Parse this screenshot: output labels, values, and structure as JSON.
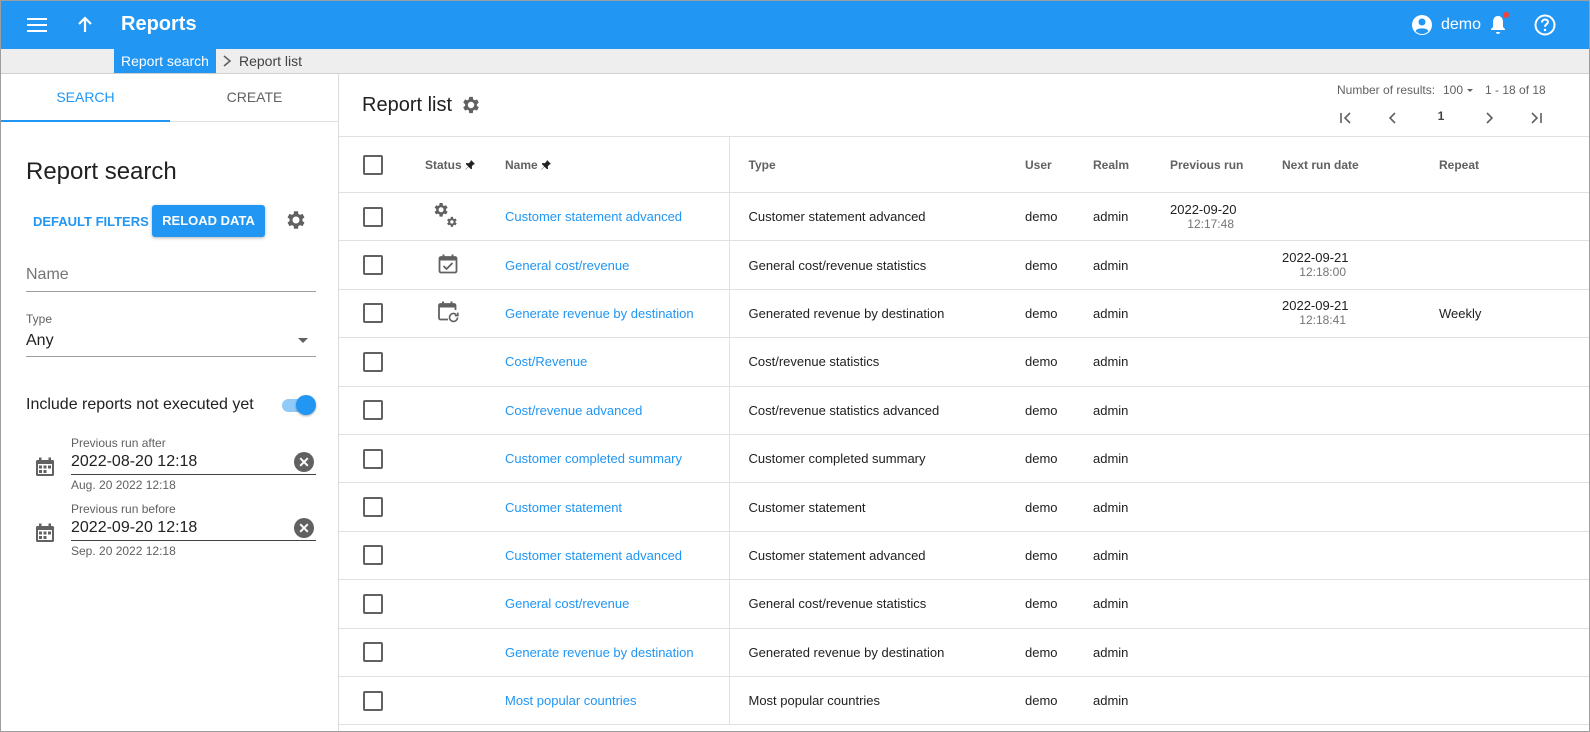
{
  "app": {
    "title": "Reports",
    "user": "demo"
  },
  "breadcrumb": {
    "link": "Report search",
    "current": "Report list"
  },
  "left": {
    "tabs": [
      {
        "label": "SEARCH"
      },
      {
        "label": "CREATE"
      }
    ],
    "title": "Report search",
    "default_filters": "DEFAULT FILTERS",
    "reload": "RELOAD DATA",
    "name_placeholder": "Name",
    "type_label": "Type",
    "type_value": "Any",
    "toggle_label": "Include reports not executed yet",
    "toggle_on": true,
    "after": {
      "label": "Previous run after",
      "value": "2022-08-20 12:18",
      "hint": "Aug. 20 2022 12:18"
    },
    "before": {
      "label": "Previous run before",
      "value": "2022-09-20 12:18",
      "hint": "Sep. 20 2022 12:18"
    }
  },
  "right": {
    "title": "Report list",
    "results_label": "Number of results:",
    "results_value": "100",
    "range": "1 - 18 of 18",
    "page": "1",
    "columns": {
      "status": "Status",
      "name": "Name",
      "type": "Type",
      "user": "User",
      "realm": "Realm",
      "prev": "Previous run",
      "next": "Next run date",
      "repeat": "Repeat"
    },
    "rows": [
      {
        "status": "gears-icon",
        "name": "Customer statement advanced",
        "type": "Customer statement advanced",
        "user": "demo",
        "realm": "admin",
        "prev_date": "2022-09-20",
        "prev_time": "12:17:48",
        "next_date": "",
        "next_time": "",
        "repeat": ""
      },
      {
        "status": "calendar-check-icon",
        "name": "General cost/revenue",
        "type": "General cost/revenue statistics",
        "user": "demo",
        "realm": "admin",
        "prev_date": "",
        "prev_time": "",
        "next_date": "2022-09-21",
        "next_time": "12:18:00",
        "repeat": ""
      },
      {
        "status": "calendar-repeat-icon",
        "name": "Generate revenue by destination",
        "type": "Generated revenue by destination",
        "user": "demo",
        "realm": "admin",
        "prev_date": "",
        "prev_time": "",
        "next_date": "2022-09-21",
        "next_time": "12:18:41",
        "repeat": "Weekly"
      },
      {
        "status": "",
        "name": "Cost/Revenue",
        "type": "Cost/revenue statistics",
        "user": "demo",
        "realm": "admin",
        "prev_date": "",
        "prev_time": "",
        "next_date": "",
        "next_time": "",
        "repeat": ""
      },
      {
        "status": "",
        "name": "Cost/revenue advanced",
        "type": "Cost/revenue statistics advanced",
        "user": "demo",
        "realm": "admin",
        "prev_date": "",
        "prev_time": "",
        "next_date": "",
        "next_time": "",
        "repeat": ""
      },
      {
        "status": "",
        "name": "Customer completed summary",
        "type": "Customer completed summary",
        "user": "demo",
        "realm": "admin",
        "prev_date": "",
        "prev_time": "",
        "next_date": "",
        "next_time": "",
        "repeat": ""
      },
      {
        "status": "",
        "name": "Customer statement",
        "type": "Customer statement",
        "user": "demo",
        "realm": "admin",
        "prev_date": "",
        "prev_time": "",
        "next_date": "",
        "next_time": "",
        "repeat": ""
      },
      {
        "status": "",
        "name": "Customer statement advanced",
        "type": "Customer statement advanced",
        "user": "demo",
        "realm": "admin",
        "prev_date": "",
        "prev_time": "",
        "next_date": "",
        "next_time": "",
        "repeat": ""
      },
      {
        "status": "",
        "name": "General cost/revenue",
        "type": "General cost/revenue statistics",
        "user": "demo",
        "realm": "admin",
        "prev_date": "",
        "prev_time": "",
        "next_date": "",
        "next_time": "",
        "repeat": ""
      },
      {
        "status": "",
        "name": "Generate revenue by destination",
        "type": "Generated revenue by destination",
        "user": "demo",
        "realm": "admin",
        "prev_date": "",
        "prev_time": "",
        "next_date": "",
        "next_time": "",
        "repeat": ""
      },
      {
        "status": "",
        "name": "Most popular countries",
        "type": "Most popular countries",
        "user": "demo",
        "realm": "admin",
        "prev_date": "",
        "prev_time": "",
        "next_date": "",
        "next_time": "",
        "repeat": ""
      }
    ]
  },
  "colors": {
    "primary": "#2196f3",
    "notification": "#f44336"
  }
}
